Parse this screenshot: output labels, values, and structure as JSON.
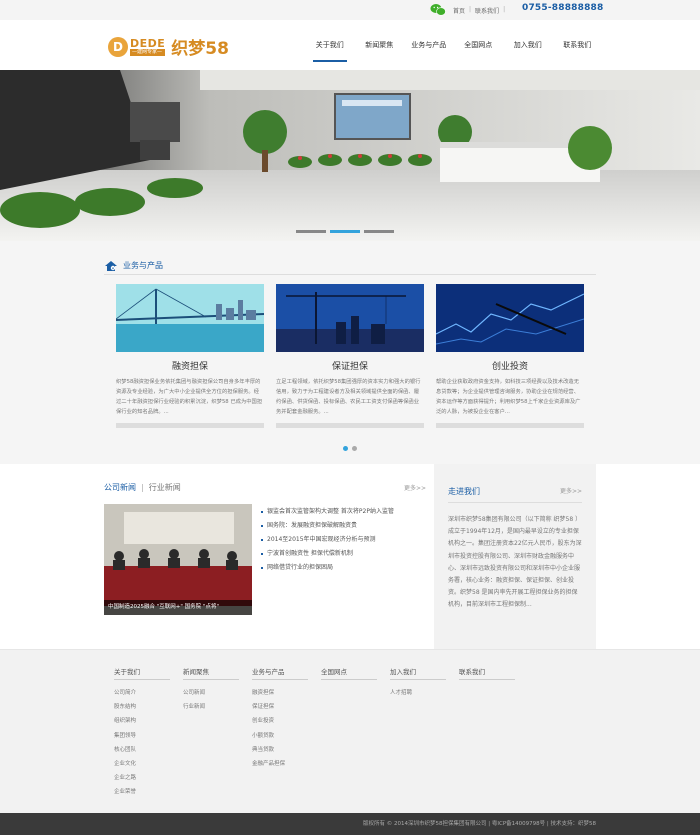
{
  "topbar": {
    "home": "首页",
    "contact": "联系我们",
    "phone": "0755-88888888"
  },
  "header": {
    "logo_letter": "D",
    "logo_dede": "DEDE",
    "logo_sub": "—建网专家—",
    "brand": "织梦58",
    "nav": [
      "关于我们",
      "新闻聚焦",
      "业务与产品",
      "全国网点",
      "加入我们",
      "联系我们"
    ]
  },
  "products": {
    "title": "业务与产品",
    "items": [
      {
        "name": "融资担保",
        "desc": "织梦58融资担保业务依托集团与融资担保公司自身多年丰厚的资源及专业经验，为广大中小企业提供全方位的担保服务。经过二十年融资担保行业经验的积累沉淀，织梦58 已成为中国担保行业的知名品牌。..."
      },
      {
        "name": "保证担保",
        "desc": "立足工程领域，依托织梦58集团强厚的资本实力和强大的银行信用，致力于为工程建设者方及相关领域提供全面的保函、履约保函、供货保函、投标保函、农民工工资支付保函等保函业务并配套金融服务。..."
      },
      {
        "name": "创业投资",
        "desc": "帮助企业获取政府资金支持，如科技三项经费以及技术改造无息贷款等；为企业提供管理咨询服务，协助企业在规范经营、资本运作等方面获得提升；利用织梦58上千家企业资源库及广泛的人脉，为被投企业在客户..."
      }
    ]
  },
  "news": {
    "tab_company": "公司新闻",
    "tab_industry": "行业新闻",
    "more": "更多>>",
    "caption": "中国制造2025融合 \"互联网+\" 国务院 \"点将\"",
    "items": [
      "银监会首次监管架构大调整 首次将P2P纳入监管",
      "国务院：发展融资担保破解融资贵",
      "2014至2015年中国宏观经济分析与预测",
      "宁波首创融资性 担保代偿新机制",
      "网络借贷行业的担保困局"
    ]
  },
  "about": {
    "title": "走进我们",
    "more": "更多>>",
    "text": "深圳市织梦58集团有限公司（以下简称 织梦58 ）成立于1994年12月，是国内最早设立的专业担保机构之一。集团注册资本22亿元人民币，股东为深圳市投资控股有限公司、深圳市财政金融服务中心、深圳市远致投资有限公司和深圳市中小企业服务署，核心业务：融资担保、保证担保、创业投资。织梦58 是国内率先开展工程担保业务的担保机构，目前深圳市工程担保制..."
  },
  "footer": {
    "columns": [
      {
        "title": "关于我们",
        "links": [
          "公司简介",
          "股东结构",
          "组织架构",
          "集团领导",
          "核心团队",
          "企业文化",
          "企业之路",
          "企业荣誉"
        ]
      },
      {
        "title": "新闻聚焦",
        "links": [
          "公司新闻",
          "行业新闻"
        ]
      },
      {
        "title": "业务与产品",
        "links": [
          "融资担保",
          "保证担保",
          "创业投资",
          "小额贷款",
          "典当贷款",
          "金融产品担保"
        ]
      },
      {
        "title": "全国网点",
        "links": []
      },
      {
        "title": "加入我们",
        "links": [
          "人才招聘"
        ]
      },
      {
        "title": "联系我们",
        "links": []
      }
    ],
    "copyright": "版权所有 © 2014深圳市织梦58担保集团有限公司 | 粤ICP备14009798号 | 技术支持：织梦58"
  },
  "colors": {
    "primary": "#1b5ea5",
    "accent": "#33a3dc",
    "brand": "#d68b22"
  },
  "icons": {
    "wechat": "wechat-icon",
    "section": "home-products-icon"
  }
}
